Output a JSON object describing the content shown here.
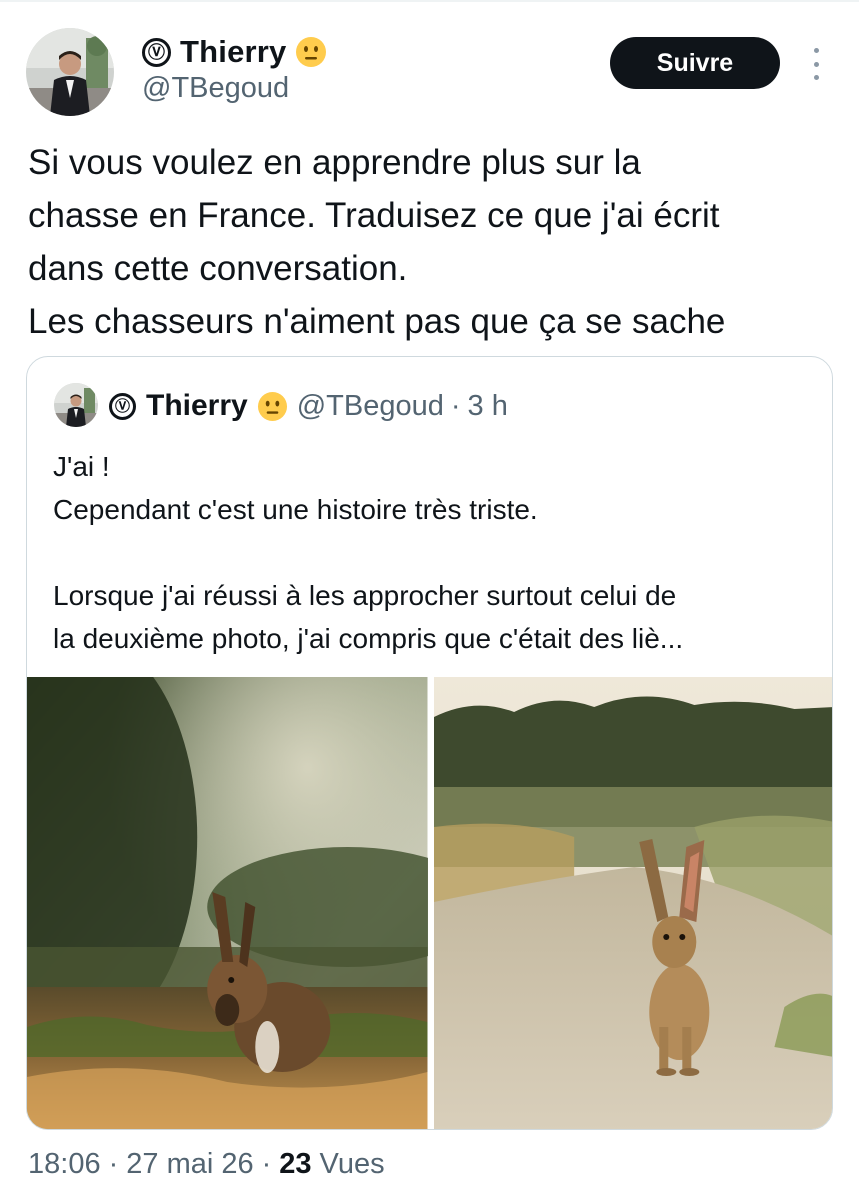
{
  "author": {
    "name": "Thierry",
    "handle": "@TBegoud",
    "verified_badge": "Ⓥ",
    "status_emoji": "neutral-face-emoji"
  },
  "follow_label": "Suivre",
  "more_icon": "more-vertical-icon",
  "tweet": {
    "lines": [
      "Si vous voulez en apprendre plus sur la",
      "chasse en France. Traduisez ce que j'ai écrit",
      "dans cette conversation.",
      "Les chasseurs n'aiment pas que ça se sache"
    ]
  },
  "quoted": {
    "name": "Thierry",
    "handle": "@TBegoud",
    "verified_badge": "Ⓥ",
    "separator": "·",
    "time": "3 h",
    "lines": [
      "J'ai !",
      "Cependant c'est une histoire très triste.",
      "",
      "Lorsque j'ai réussi à les approcher surtout celui de",
      "la deuxième photo, j'ai compris que c'était des liè..."
    ],
    "media": [
      "hare-photo-1",
      "hare-photo-2"
    ]
  },
  "meta": {
    "time": "18:06",
    "date": "27 mai 26",
    "separator": "·",
    "views_count": "23",
    "views_label": "Vues"
  },
  "colors": {
    "text": "#0f1419",
    "secondary": "#536471",
    "border": "#cfd9de",
    "button_bg": "#0f1419"
  }
}
